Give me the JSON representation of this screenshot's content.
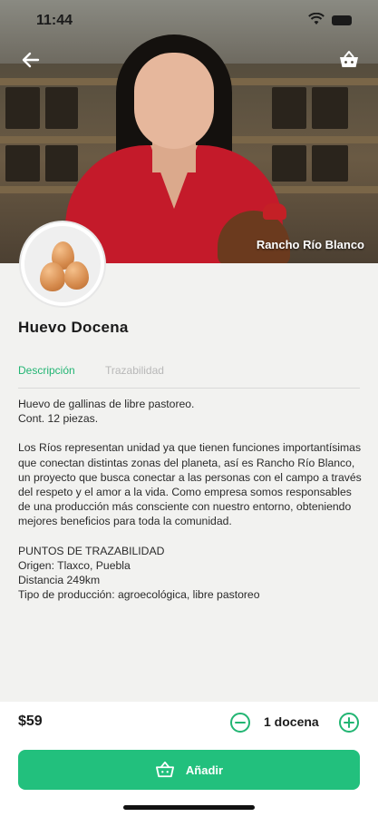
{
  "status_bar": {
    "time": "11:44",
    "wifi_icon": "wifi-icon",
    "battery_icon": "battery-icon"
  },
  "header": {
    "back_icon": "back-arrow-icon",
    "cart_icon": "basket-icon"
  },
  "hero": {
    "producer_name": "Rancho Río Blanco"
  },
  "product": {
    "title": "Huevo Docena",
    "image_icon": "eggs-icon"
  },
  "tabs": [
    {
      "label": "Descripción",
      "active": true
    },
    {
      "label": "Trazabilidad",
      "active": false
    }
  ],
  "description": {
    "intro_line1": "Huevo de gallinas de libre pastoreo.",
    "intro_line2": "Cont. 12 piezas.",
    "body": "Los Ríos representan unidad ya que tienen funciones importantísimas que conectan distintas zonas del planeta, así es Rancho Río Blanco, un proyecto que busca conectar a las personas con el campo a través del respeto y el amor a la vida. Como empresa somos responsables de una producción más consciente con nuestro entorno, obteniendo mejores beneficios para toda la comunidad.",
    "points_title": "PUNTOS DE TRAZABILIDAD",
    "origin": "Origen: Tlaxco, Puebla",
    "distance": "Distancia 249km",
    "production_type": "Tipo de producción: agroecológica, libre pastoreo"
  },
  "footer": {
    "price": "$59",
    "quantity": "1 docena",
    "minus_icon": "minus-circle-icon",
    "plus_icon": "plus-circle-icon",
    "add_label": "Añadir",
    "add_icon": "basket-icon"
  },
  "colors": {
    "accent": "#22c07d",
    "tab_active": "#22b573",
    "tab_inactive": "#b8b8b8",
    "background": "#f2f2f0"
  }
}
